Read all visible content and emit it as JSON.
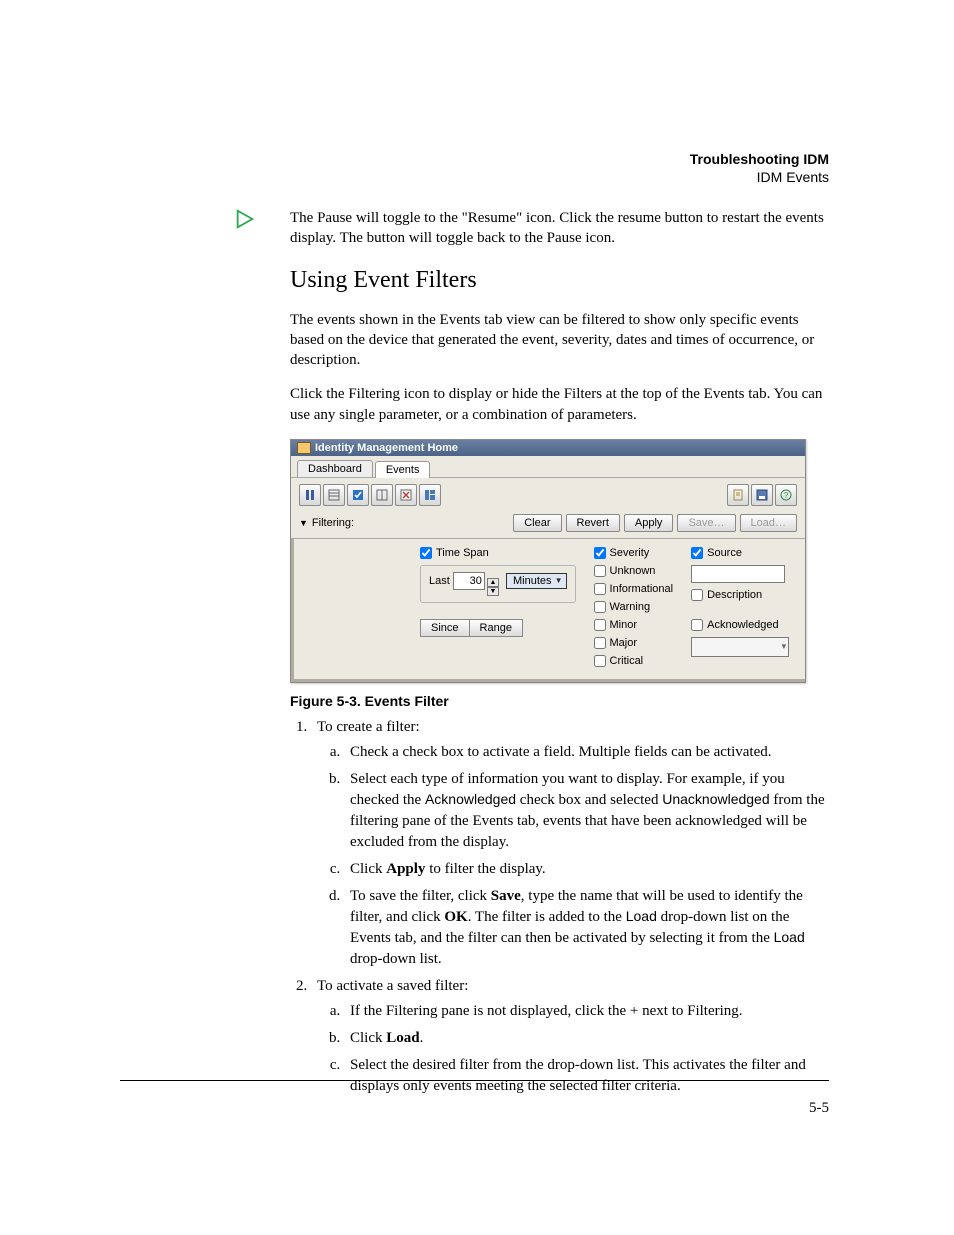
{
  "header": {
    "title": "Troubleshooting IDM",
    "subtitle": "IDM Events"
  },
  "intro_para": "The Pause will toggle to the \"Resume\" icon. Click the resume button to restart the events display. The button will toggle back to the Pause icon.",
  "section_heading": "Using Event Filters",
  "para1": "The events shown in the Events tab view can be filtered to show only specific events based on the device that generated the event, severity, dates and times of occurrence, or description.",
  "para2": "Click the Filtering icon to display or hide the Filters at the top of the Events tab. You can use any single parameter, or a combination of parameters.",
  "figure": {
    "caption": "Figure 5-3. Events Filter",
    "window_title": "Identity Management Home",
    "tabs": {
      "dashboard": "Dashboard",
      "events": "Events"
    },
    "filtering_label": "Filtering:",
    "buttons": {
      "clear": "Clear",
      "revert": "Revert",
      "apply": "Apply",
      "save": "Save…",
      "load": "Load…"
    },
    "timespan": {
      "label": "Time Span",
      "last": "Last",
      "value": "30",
      "unit": "Minutes",
      "since": "Since",
      "range": "Range"
    },
    "severity": {
      "label": "Severity",
      "unknown": "Unknown",
      "informational": "Informational",
      "warning": "Warning",
      "minor": "Minor",
      "major": "Major",
      "critical": "Critical"
    },
    "source": {
      "label": "Source",
      "description": "Description",
      "acknowledged": "Acknowledged"
    }
  },
  "list": {
    "item1_intro": "To create a filter:",
    "item1a": "Check a check box to activate a field. Multiple fields can be activated.",
    "item1b_part1": "Select each type of information you want to display. For example, if you checked the ",
    "item1b_mono1": "Acknowledged",
    "item1b_part2": " check box and selected ",
    "item1b_mono2": "Unacknowledged",
    "item1b_part3": " from the filtering pane of the Events tab, events that have been acknowledged will be excluded from the display.",
    "item1c_part1": "Click ",
    "item1c_strong": "Apply",
    "item1c_part2": " to filter the display.",
    "item1d_part1": "To save the filter, click ",
    "item1d_strong1": "Save",
    "item1d_part2": ", type the name that will be used to identify the filter, and click ",
    "item1d_strong2": "OK",
    "item1d_part3": ". The filter is added to the ",
    "item1d_mono1": "Load",
    "item1d_part4": " drop-down list on the Events tab, and the filter can then be activated by selecting it from the ",
    "item1d_mono2": "Load",
    "item1d_part5": " drop-down list.",
    "item2_intro": "To activate a saved filter:",
    "item2a": "If the Filtering pane is not displayed, click the + next to Filtering.",
    "item2b_part1": "Click ",
    "item2b_strong": "Load",
    "item2b_part2": ".",
    "item2c": "Select the desired filter from the drop-down list. This activates the filter and displays only events meeting the selected filter criteria."
  },
  "page_number": "5-5"
}
